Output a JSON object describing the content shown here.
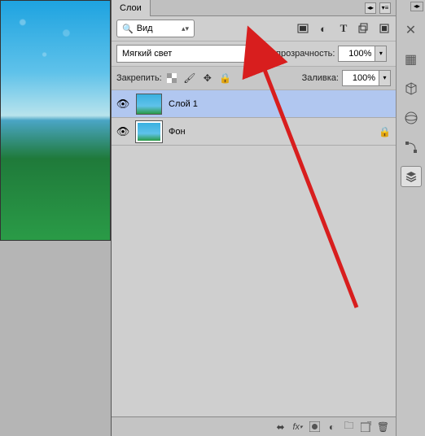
{
  "panel": {
    "tab_title": "Слои",
    "search": {
      "label": "Вид"
    },
    "top_icons": [
      "image-icon",
      "adjustment-icon",
      "type-icon",
      "transform-icon",
      "mask-icon"
    ],
    "blend_mode": "Мягкий свет",
    "opacity": {
      "label": "Непрозрачность:",
      "value": "100%"
    },
    "lock": {
      "label": "Закрепить:"
    },
    "fill": {
      "label": "Заливка:",
      "value": "100%"
    },
    "layers": [
      {
        "name": "Слой 1",
        "visible": true,
        "locked": false,
        "selected": true
      },
      {
        "name": "Фон",
        "visible": true,
        "locked": true,
        "selected": false
      }
    ],
    "footer_icons": [
      "link-icon",
      "fx-icon",
      "mask-footer-icon",
      "adjust-footer-icon",
      "folder-icon",
      "new-layer-icon",
      "trash-icon"
    ]
  },
  "dock": {
    "icons": [
      "tools-icon",
      "swatches-icon",
      "3d-icon",
      "materials-icon",
      "path-icon",
      "layers-dock-icon"
    ]
  }
}
